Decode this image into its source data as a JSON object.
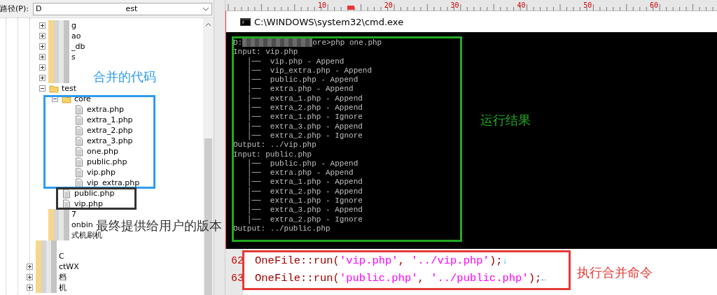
{
  "path_bar": {
    "label": "路径(P):",
    "value_start": "D",
    "value_end": "est"
  },
  "tree": {
    "groups": [
      {
        "items": [
          {
            "kind": "folder",
            "label": "g",
            "expanded": false,
            "obscured": true
          },
          {
            "kind": "folder",
            "label": "ao",
            "expanded": false,
            "obscured": true
          },
          {
            "kind": "folder",
            "label": "_db",
            "expanded": false,
            "obscured": true
          },
          {
            "kind": "folder",
            "label": "s",
            "expanded": false,
            "obscured": true
          },
          {
            "kind": "folder",
            "expanded": false,
            "obscured": true
          },
          {
            "kind": "folder",
            "expanded": false,
            "obscured": true
          },
          {
            "kind": "folder",
            "label": "test",
            "expanded": true,
            "children": [
              {
                "kind": "folder",
                "label": "core",
                "expanded": true,
                "children": [
                  {
                    "kind": "file",
                    "label": "extra.php"
                  },
                  {
                    "kind": "file",
                    "label": "extra_1.php"
                  },
                  {
                    "kind": "file",
                    "label": "extra_2.php"
                  },
                  {
                    "kind": "file",
                    "label": "extra_3.php"
                  },
                  {
                    "kind": "file",
                    "label": "one.php"
                  },
                  {
                    "kind": "file",
                    "label": "public.php"
                  },
                  {
                    "kind": "file",
                    "label": "vip.php"
                  },
                  {
                    "kind": "file",
                    "label": "vip_extra.php"
                  }
                ]
              },
              {
                "kind": "file",
                "label": "public.php"
              },
              {
                "kind": "file",
                "label": "vip.php"
              }
            ]
          },
          {
            "kind": "folder",
            "label": "7",
            "obscured": true
          },
          {
            "kind": "folder",
            "label": "onbin",
            "obscured": true
          },
          {
            "kind": "folder",
            "label": "式机刷机",
            "obscured": true
          }
        ]
      },
      {
        "items": [
          {
            "kind": "folder",
            "obscured": true
          },
          {
            "kind": "folder",
            "label": "C",
            "obscured": true
          },
          {
            "kind": "folder",
            "label": "ctWX",
            "expanded": false,
            "obscured": true
          },
          {
            "kind": "folder",
            "label": "档",
            "expanded": false,
            "obscured": true
          },
          {
            "kind": "folder",
            "label": "机",
            "expanded": false,
            "obscured": true
          }
        ]
      }
    ]
  },
  "ruler": {
    "labels": [
      "10",
      "20",
      "30",
      "40",
      "50",
      "60"
    ]
  },
  "cmd": {
    "title": "C:\\WINDOWS\\system32\\cmd.exe",
    "prompt": {
      "drive": "D:",
      "command": "ore>php one.php"
    },
    "lines": [
      "Input: vip.php",
      "   │──  vip.php - Append",
      "   │──  vip_extra.php - Append",
      "   │──  public.php - Append",
      "   │──  extra.php - Append",
      "   │──  extra_1.php - Append",
      "   │──  extra_2.php - Append",
      "   │──  extra_1.php - Ignore",
      "   │──  extra_3.php - Append",
      "   │──  extra_2.php - Ignore",
      "Output: ../vip.php",
      "Input: public.php",
      "   │──  public.php - Append",
      "   │──  extra.php - Append",
      "   │──  extra_1.php - Append",
      "   │──  extra_2.php - Append",
      "   │──  extra_1.php - Ignore",
      "   │──  extra_3.php - Append",
      "   │──  extra_2.php - Ignore",
      "Output: ../public.php"
    ]
  },
  "code": {
    "lines": [
      {
        "number": "62",
        "parts": [
          {
            "kind": "plain",
            "text": "OneFile::run("
          },
          {
            "kind": "string",
            "text": "'vip.php'"
          },
          {
            "kind": "plain",
            "text": ", "
          },
          {
            "kind": "string",
            "text": "'../vip.php'"
          },
          {
            "kind": "plain",
            "text": ");"
          },
          {
            "kind": "eol",
            "text": "↓"
          }
        ]
      },
      {
        "number": "63",
        "parts": [
          {
            "kind": "plain",
            "text": "OneFile::run("
          },
          {
            "kind": "string",
            "text": "'public.php'"
          },
          {
            "kind": "plain",
            "text": ", "
          },
          {
            "kind": "string",
            "text": "'../public.php'"
          },
          {
            "kind": "plain",
            "text": ");"
          },
          {
            "kind": "eol",
            "text": "←"
          }
        ]
      }
    ]
  },
  "annotations": [
    {
      "kind": "box",
      "color": "#2e9bf0"
    },
    {
      "kind": "label",
      "text": "合并的代码",
      "color": "#2e9bf0"
    },
    {
      "kind": "box",
      "color": "#333333"
    },
    {
      "kind": "label",
      "text": "最终提供给用户的版本",
      "color": "#333333"
    },
    {
      "kind": "box",
      "color": "#22aa22"
    },
    {
      "kind": "label",
      "text": "运行结果",
      "color": "#22aa22"
    },
    {
      "kind": "box",
      "color": "#e53935"
    },
    {
      "kind": "label",
      "text": "执行合并命令",
      "color": "#e53935"
    }
  ]
}
